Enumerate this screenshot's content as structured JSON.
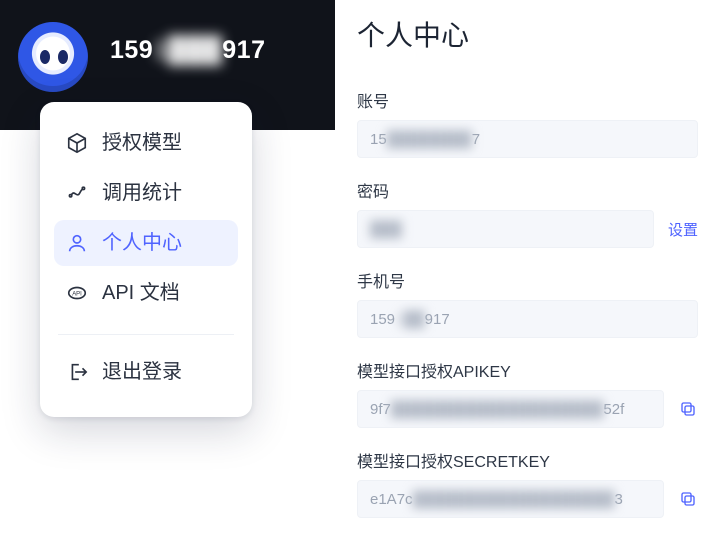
{
  "header": {
    "username_prefix": "159",
    "username_mask": "1███",
    "username_suffix": "917"
  },
  "menu": {
    "items": [
      {
        "icon": "cube-icon",
        "label": "授权模型"
      },
      {
        "icon": "stats-icon",
        "label": "调用统计"
      },
      {
        "icon": "user-icon",
        "label": "个人中心"
      },
      {
        "icon": "api-icon",
        "label": "API 文档"
      }
    ],
    "active_index": 2,
    "logout_label": "退出登录"
  },
  "page": {
    "title": "个人中心",
    "fields": {
      "account": {
        "label": "账号",
        "prefix": "15",
        "mask": "████████",
        "suffix": "7"
      },
      "password": {
        "label": "密码",
        "mask": "███",
        "action": "设置"
      },
      "phone": {
        "label": "手机号",
        "prefix": "159",
        "mask": "1██",
        "suffix": "917"
      },
      "apikey": {
        "label": "模型接口授权APIKEY",
        "prefix": "9f7",
        "mask": "████████████████████",
        "suffix": "52f"
      },
      "secretkey": {
        "label": "模型接口授权SECRETKEY",
        "prefix": "e1A7c",
        "mask": "███████████████████",
        "suffix": "3"
      }
    }
  },
  "colors": {
    "accent": "#4f63ff"
  }
}
